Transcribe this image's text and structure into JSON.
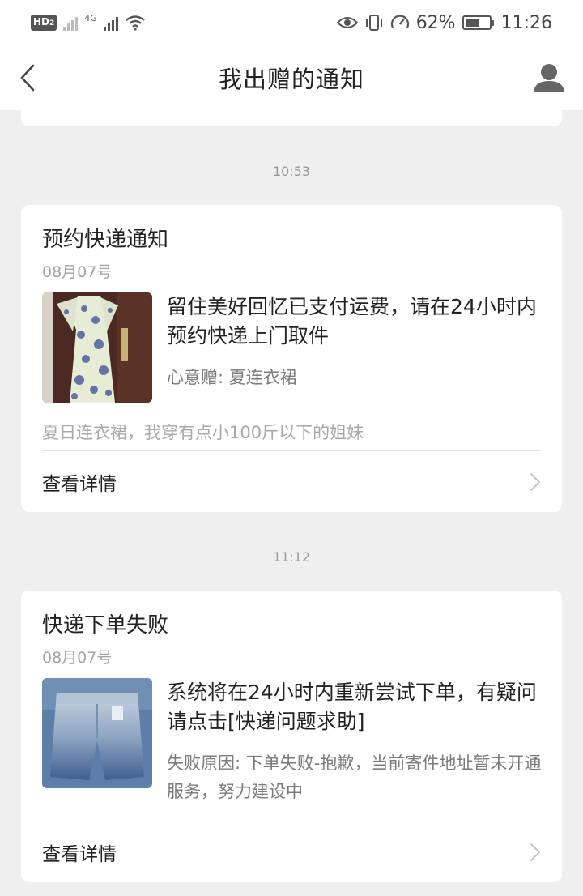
{
  "status_bar": {
    "left_badge": "HD",
    "left_badge_sub": "2",
    "net_label": "4G",
    "battery": "62%",
    "battery_level": 0.62,
    "time": "11:26"
  },
  "header": {
    "title": "我出赠的通知"
  },
  "notifications": [
    {
      "time": "10:53",
      "title": "预约快递通知",
      "date": "08月07号",
      "message": "留住美好回忆已支付运费，请在24小时内预约快递上门取件",
      "sub": "心意赠: 夏连衣裙",
      "description": "夏日连衣裙，我穿有点小100斤以下的姐妹",
      "detail_label": "查看详情"
    },
    {
      "time": "11:12",
      "title": "快递下单失败",
      "date": "08月07号",
      "message": "系统将在24小时内重新尝试下单，有疑问请点击[快递问题求助]",
      "sub": "失败原因: 下单失败-抱歉，当前寄件地址暂未开通服务，努力建设中",
      "detail_label": "查看详情"
    }
  ],
  "colors": {
    "background": "#efefef",
    "card": "#ffffff",
    "muted_text": "#a3a3a3"
  }
}
